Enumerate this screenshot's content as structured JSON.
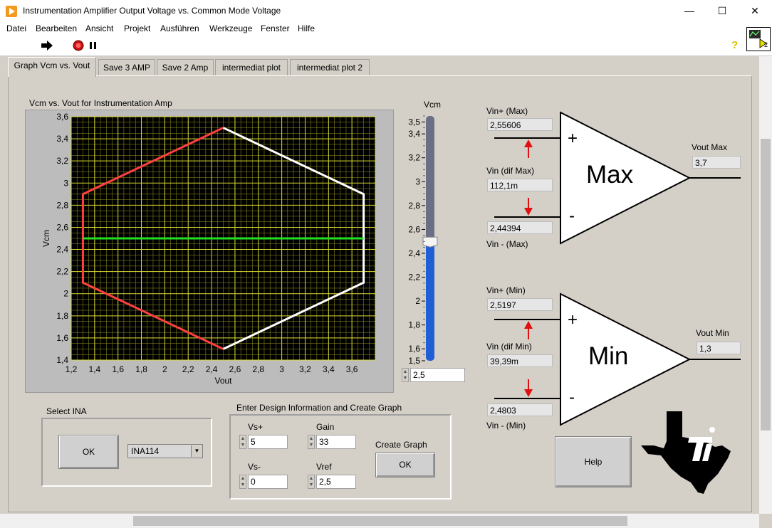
{
  "window": {
    "title": "Instrumentation Amplifier Output Voltage vs. Common Mode Voltage",
    "minimize": "—",
    "maximize": "☐",
    "close": "✕"
  },
  "menu": [
    "Datei",
    "Bearbeiten",
    "Ansicht",
    "Projekt",
    "Ausführen",
    "Werkzeuge",
    "Fenster",
    "Hilfe"
  ],
  "toolbar": {
    "help_icon": "?",
    "vi_icon_label": "2"
  },
  "tabs": [
    "Graph Vcm vs. Vout",
    "Save 3 AMP",
    "Save 2 Amp",
    "intermediat plot",
    "intermediat plot 2"
  ],
  "chart_data": {
    "type": "line",
    "title": "Vcm vs. Vout for Instrumentation Amp",
    "xlabel": "Vout",
    "ylabel": "Vcm",
    "xlim": [
      1.2,
      3.8
    ],
    "ylim": [
      1.4,
      3.6
    ],
    "xticks": [
      "1,2",
      "1,4",
      "1,6",
      "1,8",
      "2",
      "2,2",
      "2,4",
      "2,6",
      "2,8",
      "3",
      "3,2",
      "3,4",
      "3,6"
    ],
    "yticks": [
      "1,4",
      "1,6",
      "1,8",
      "2",
      "2,2",
      "2,4",
      "2,6",
      "2,8",
      "3",
      "3,2",
      "3,4",
      "3,6"
    ],
    "grid": true,
    "background": "#000000",
    "gridcolor": "#9a9a20",
    "series": [
      {
        "color": "#ff4040",
        "x": [
          2.5,
          1.3,
          1.3,
          2.5
        ],
        "y": [
          3.5,
          2.9,
          2.1,
          1.5
        ]
      },
      {
        "color": "#ffffff",
        "x": [
          2.5,
          3.7,
          3.7,
          2.5
        ],
        "y": [
          3.5,
          2.9,
          2.1,
          1.5
        ]
      },
      {
        "color": "#22e022",
        "x": [
          1.3,
          3.7
        ],
        "y": [
          2.5,
          2.5
        ]
      }
    ]
  },
  "slider": {
    "label": "Vcm",
    "min": 1.5,
    "max": 3.55,
    "value": 2.5,
    "value_text": "2,5",
    "ticks": [
      "3,5",
      "3,4",
      "3,2",
      "3",
      "2,8",
      "2,6",
      "2,4",
      "2,2",
      "2",
      "1,8",
      "1,6",
      "1,5"
    ],
    "tick_values": [
      3.5,
      3.4,
      3.2,
      3.0,
      2.8,
      2.6,
      2.4,
      2.2,
      2.0,
      1.8,
      1.6,
      1.5
    ],
    "fill_color": "#1f5fd6",
    "track_color": "#6a6f86"
  },
  "amp_max": {
    "vin_plus_label": "Vin+ (Max)",
    "vin_plus": "2,55606",
    "vin_dif_label": "Vin (dif Max)",
    "vin_dif": "112,1m",
    "vin_minus_label": "Vin - (Max)",
    "vin_minus": "2,44394",
    "vout_label": "Vout Max",
    "vout": "3,7",
    "name": "Max",
    "plus": "+",
    "minus": "-"
  },
  "amp_min": {
    "vin_plus_label": "Vin+ (Min)",
    "vin_plus": "2,5197",
    "vin_dif_label": "Vin (dif Min)",
    "vin_dif": "39,39m",
    "vin_minus_label": "Vin - (Min)",
    "vin_minus": "2,4803",
    "vout_label": "Vout Min",
    "vout": "1,3",
    "name": "Min",
    "plus": "+",
    "minus": "-"
  },
  "select_ina": {
    "label": "Select INA",
    "ok": "OK",
    "selected": "INA114"
  },
  "design": {
    "label": "Enter Design Information and Create Graph",
    "vs_plus_label": "Vs+",
    "vs_plus": "5",
    "gain_label": "Gain",
    "gain": "33",
    "vs_minus_label": "Vs-",
    "vs_minus": "0",
    "vref_label": "Vref",
    "vref": "2,5",
    "create_label": "Create Graph",
    "create_ok": "OK"
  },
  "help_button": "Help",
  "colors": {
    "arrow": "#e01010",
    "amp_fill": "#ffffff"
  }
}
